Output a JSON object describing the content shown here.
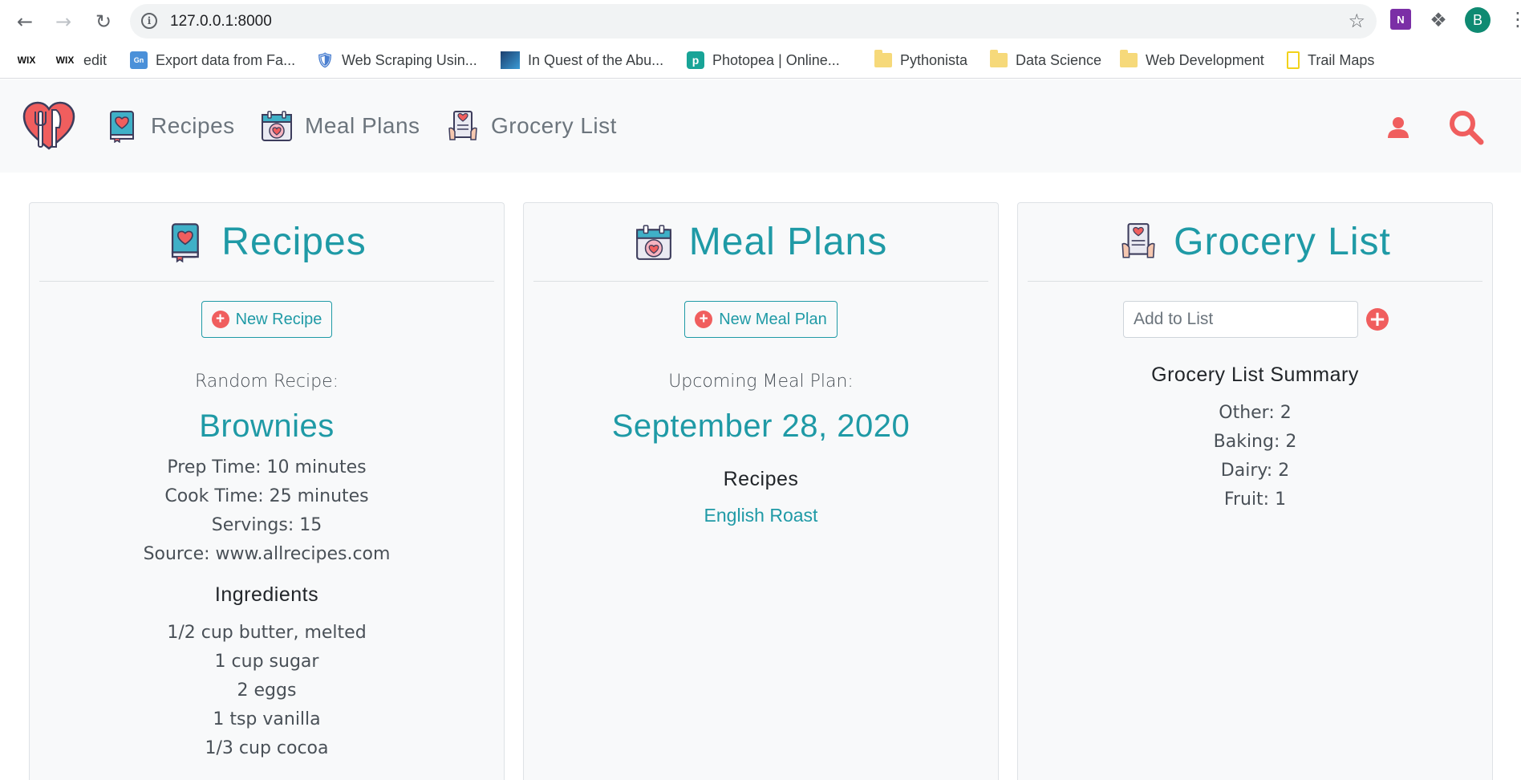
{
  "browser": {
    "url": "127.0.0.1:8000",
    "avatar_letter": "B",
    "onenote_label": "N",
    "bookmarks": [
      {
        "label": "",
        "icon": "wix-icon"
      },
      {
        "label": "edit",
        "icon": "wix-icon"
      },
      {
        "label": "Export data from Fa...",
        "icon": "gn-icon"
      },
      {
        "label": "Web Scraping Usin...",
        "icon": "shield-icon"
      },
      {
        "label": "In Quest of the Abu...",
        "icon": "quest-icon"
      },
      {
        "label": "Photopea | Online...",
        "icon": "photopea-icon"
      },
      {
        "label": "Pythonista",
        "icon": "folder-icon"
      },
      {
        "label": "Data Science",
        "icon": "folder-icon"
      },
      {
        "label": "Web Development",
        "icon": "folder-icon"
      },
      {
        "label": "Trail Maps",
        "icon": "trail-icon"
      }
    ],
    "wix_label": "WIX"
  },
  "nav": {
    "recipes": "Recipes",
    "meal_plans": "Meal Plans",
    "grocery_list": "Grocery List"
  },
  "recipes_card": {
    "title": "Recipes",
    "new_button": "New Recipe",
    "random_label": "Random Recipe:",
    "recipe_name": "Brownies",
    "prep_time": "Prep Time: 10 minutes",
    "cook_time": "Cook Time: 25 minutes",
    "servings": "Servings: 15",
    "source": "Source: www.allrecipes.com",
    "ingredients_heading": "Ingredients",
    "ingredients": [
      "1/2 cup butter, melted",
      "1 cup sugar",
      "2 eggs",
      "1 tsp vanilla",
      "1/3 cup cocoa"
    ]
  },
  "meal_plans_card": {
    "title": "Meal Plans",
    "new_button": "New Meal Plan",
    "upcoming_label": "Upcoming Meal Plan:",
    "date": "September 28, 2020",
    "recipes_heading": "Recipes",
    "recipes": [
      "English Roast"
    ]
  },
  "grocery_card": {
    "title": "Grocery List",
    "input_placeholder": "Add to List",
    "summary_heading": "Grocery List Summary",
    "summary": [
      "Other: 2",
      "Baking: 2",
      "Dairy: 2",
      "Fruit: 1"
    ]
  },
  "colors": {
    "accent": "#1f9aa6",
    "danger": "#f05e5e",
    "nav_bg": "#f8f9fa"
  }
}
